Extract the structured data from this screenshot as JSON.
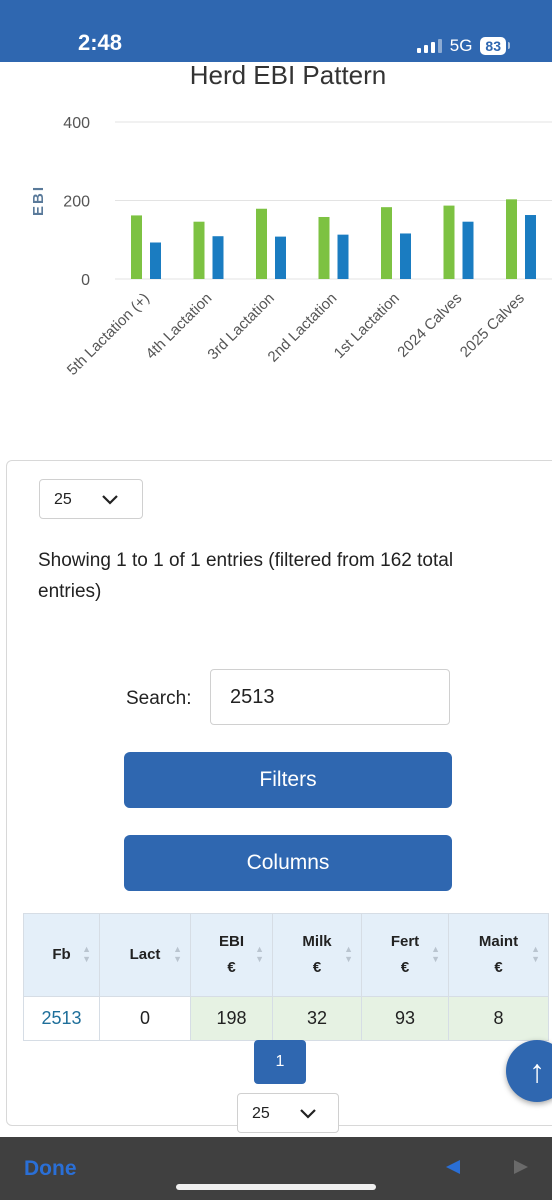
{
  "status": {
    "time": "2:48",
    "network": "5G",
    "battery": "83"
  },
  "chart_data": {
    "type": "bar",
    "title": "Herd EBI Pattern",
    "ylabel": "EBI",
    "xlabel": "",
    "ylim": [
      0,
      400
    ],
    "yticks": [
      0,
      200,
      400
    ],
    "categories": [
      "5th Lactation (+)",
      "4th Lactation",
      "3rd Lactation",
      "2nd Lactation",
      "1st Lactation",
      "2024 Calves",
      "2025 Calves"
    ],
    "series": [
      {
        "values": [
          162,
          146,
          179,
          158,
          183,
          187,
          203
        ],
        "color": "#7dc242"
      },
      {
        "values": [
          93,
          109,
          108,
          113,
          116,
          146,
          163
        ],
        "color": "#1a7cc1"
      }
    ]
  },
  "page_length": {
    "top": "25",
    "bottom": "25"
  },
  "info_text": "Showing 1 to 1 of 1 entries (filtered from 162 total entries)",
  "search": {
    "label": "Search:",
    "value": "2513"
  },
  "buttons": {
    "filters": "Filters",
    "columns": "Columns"
  },
  "table": {
    "headers": [
      {
        "l1": "Fb",
        "l2": ""
      },
      {
        "l1": "Lact",
        "l2": ""
      },
      {
        "l1": "EBI",
        "l2": "€"
      },
      {
        "l1": "Milk",
        "l2": "€"
      },
      {
        "l1": "Fert",
        "l2": "€"
      },
      {
        "l1": "Maint",
        "l2": "€"
      }
    ],
    "rows": [
      [
        "2513",
        "0",
        "198",
        "32",
        "93",
        "8"
      ]
    ]
  },
  "pagination": {
    "current": "1"
  },
  "scroll_top_glyph": "↑",
  "bottom_bar": {
    "done": "Done"
  },
  "colors": {
    "accent": "#2f67b0",
    "green": "#7dc242",
    "blue": "#1a7cc1"
  }
}
